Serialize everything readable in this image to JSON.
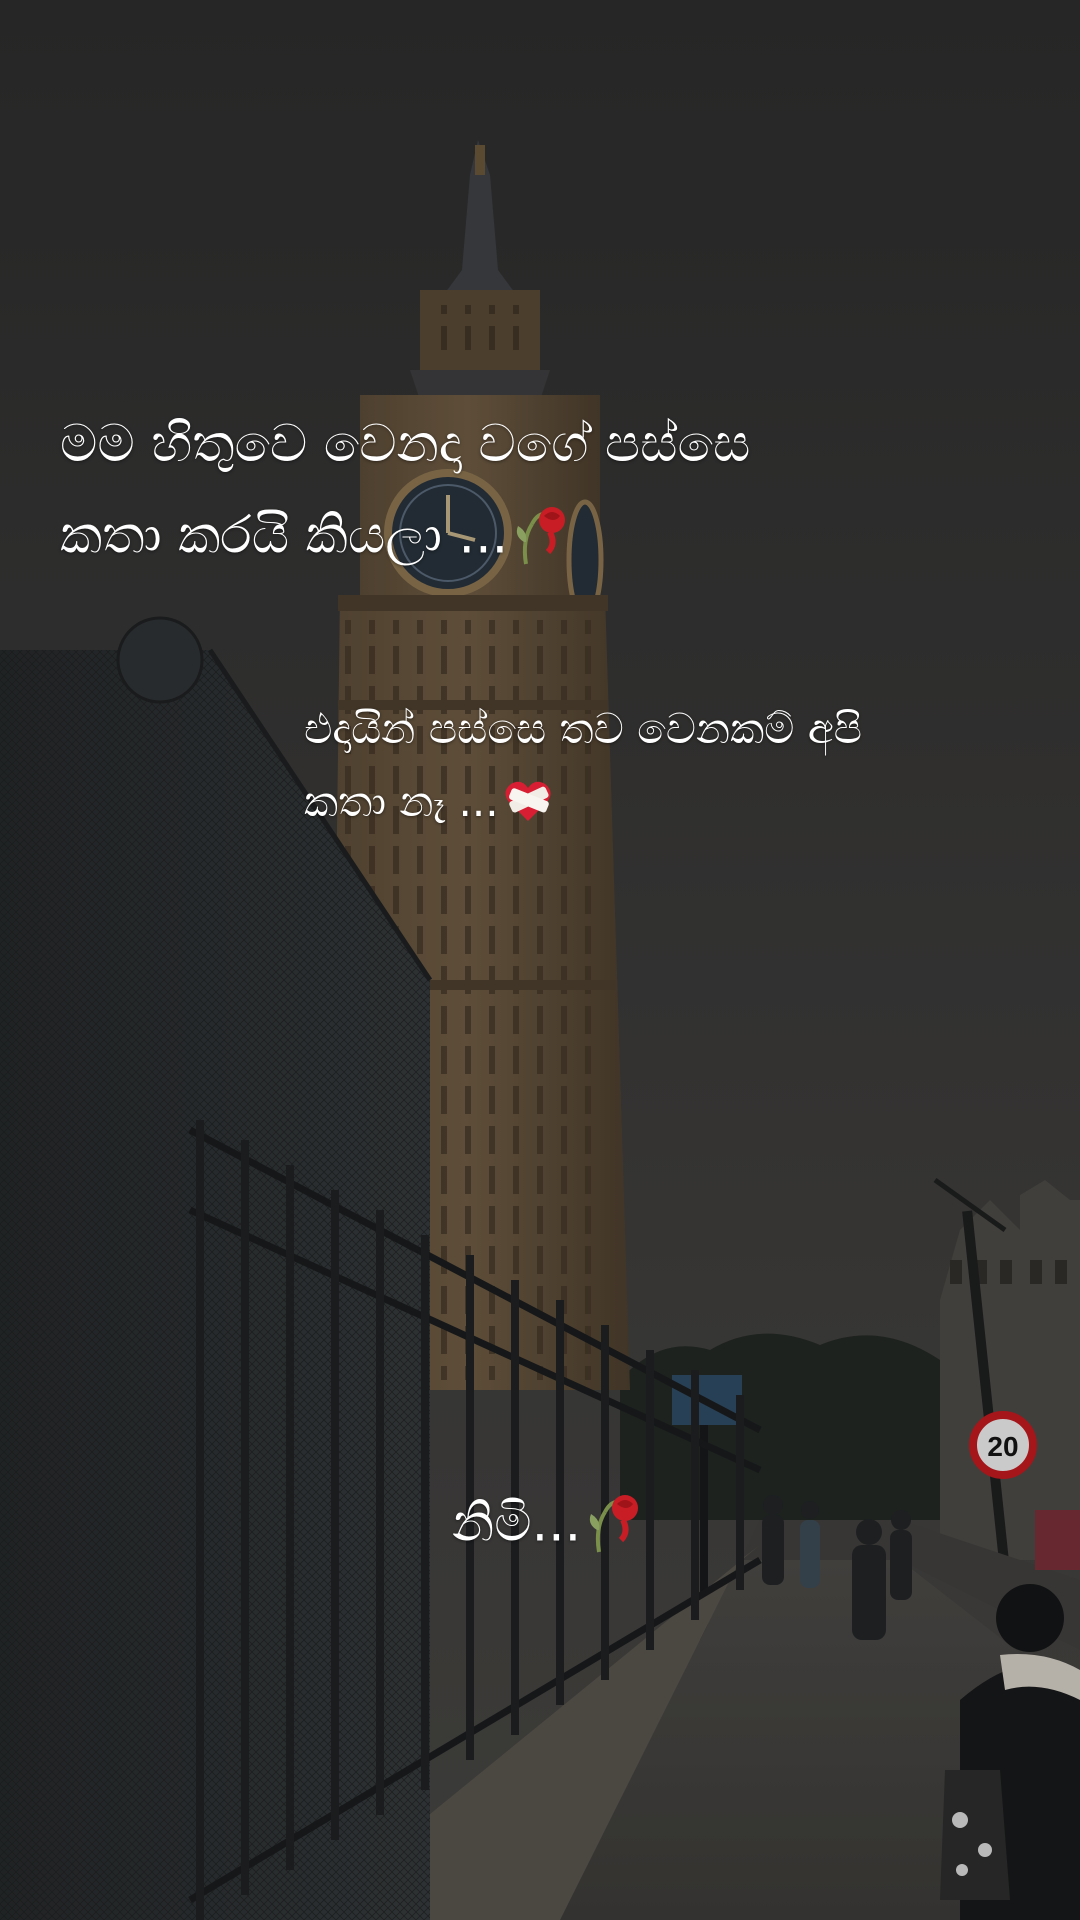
{
  "caption": {
    "line1": "මම හිතුවෙ වෙනදා වගේ පස්සෙ",
    "line2": "කතා කරයි කියලා ...",
    "line3": "එදායින් පස්සෙ තව වෙනකම් අපි",
    "line4": "කතා නෑ ...",
    "line5": "නිමි..."
  },
  "emoji": {
    "rose": "wilted-rose-icon",
    "bandaged_heart": "mending-heart-icon"
  },
  "sign": {
    "speed_limit": "20"
  }
}
